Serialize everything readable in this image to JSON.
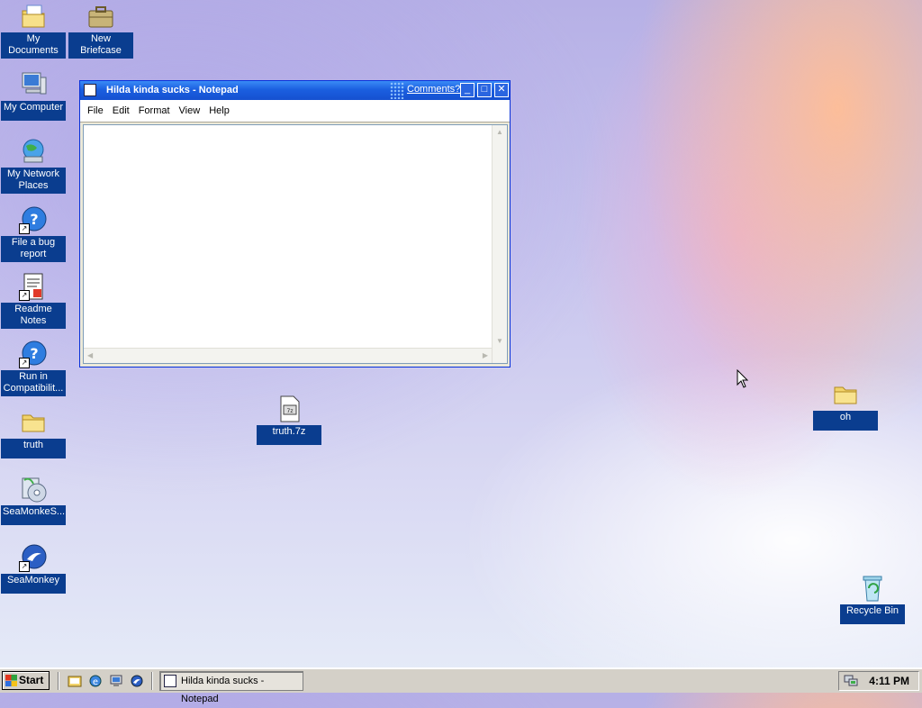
{
  "desktop": {
    "icons": [
      {
        "name": "My Documents"
      },
      {
        "name": "New Briefcase"
      },
      {
        "name": "My Computer"
      },
      {
        "name": "My Network Places"
      },
      {
        "name": "File a bug report"
      },
      {
        "name": "Readme Notes"
      },
      {
        "name": "Run in Compatibilit..."
      },
      {
        "name": "truth"
      },
      {
        "name": "SeaMonkeS..."
      },
      {
        "name": "SeaMonkey"
      },
      {
        "name": "truth.7z"
      },
      {
        "name": "oh"
      },
      {
        "name": "Recycle Bin"
      }
    ]
  },
  "notepad": {
    "title": "Hilda kinda sucks - Notepad",
    "comments_link": "Comments?",
    "menu": [
      "File",
      "Edit",
      "Format",
      "View",
      "Help"
    ],
    "content": ""
  },
  "taskbar": {
    "start_label": "Start",
    "task_button_label": "Hilda kinda sucks - Notepad",
    "clock": "4:11 PM"
  },
  "colors": {
    "titlebar": "#1b5fe0",
    "icon_label_bg": "#0a3d8f",
    "taskbar": "#d4d0c8"
  }
}
